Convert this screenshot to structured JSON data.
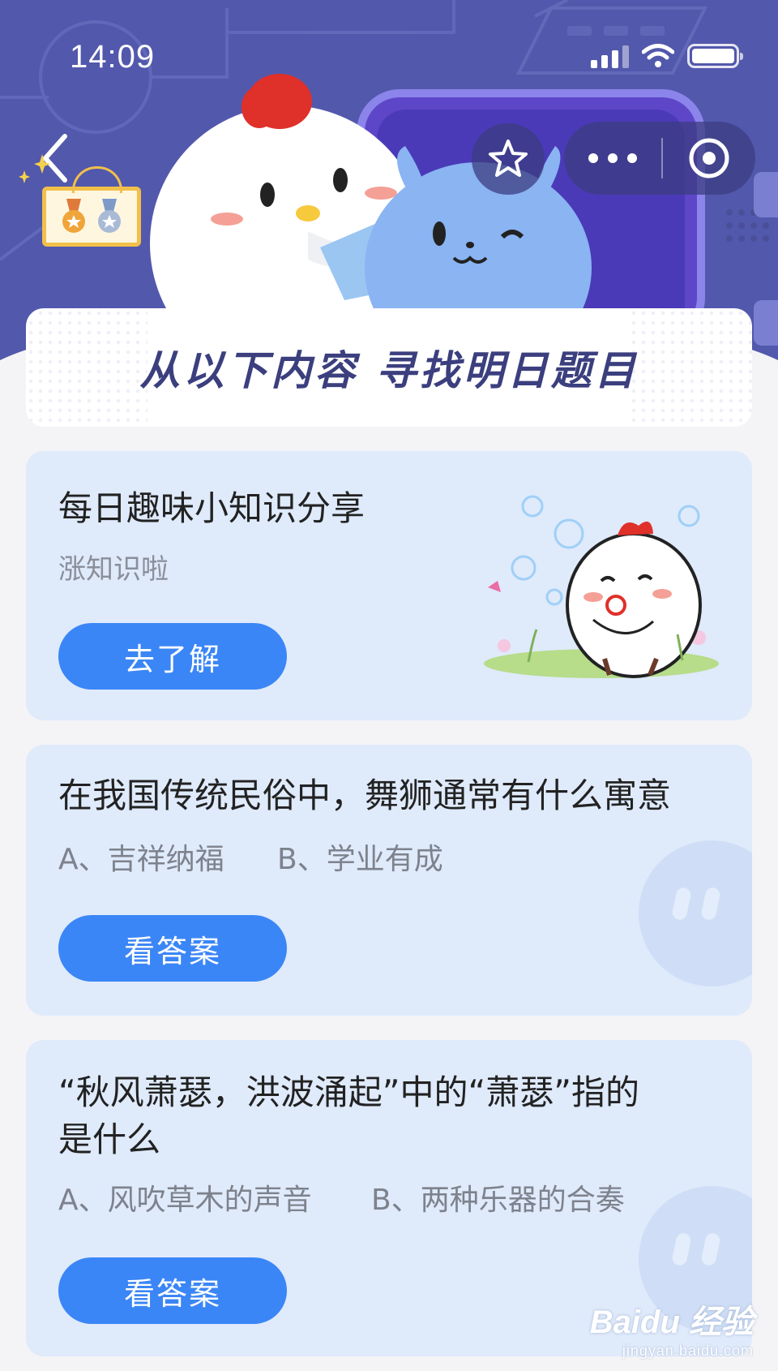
{
  "status_bar": {
    "time": "14:09"
  },
  "banner": {
    "title": "从以下内容  寻找明日题目"
  },
  "cards": [
    {
      "title": "每日趣味小知识分享",
      "subtitle": "涨知识啦",
      "button": "去了解"
    },
    {
      "title": "在我国传统民俗中，舞狮通常有什么寓意",
      "option_a": "A、吉祥纳福",
      "option_b": "B、学业有成",
      "button": "看答案"
    },
    {
      "title_line1": "“秋风萧瑟，洪波涌起”中的“萧瑟”指的",
      "title_line2": "是什么",
      "option_a": "A、风吹草木的声音",
      "option_b": "B、两种乐器的合奏",
      "button": "看答案"
    }
  ],
  "watermark": {
    "brand": "Baidu 经验",
    "url": "jingyan.baidu.com"
  },
  "colors": {
    "header_bg": "#5258ac",
    "card_bg": "#dfeafb",
    "button_blue": "#3b86f6",
    "banner_text": "#3b3f7e"
  },
  "icons": [
    "back-arrow-icon",
    "star-icon",
    "more-dots-icon",
    "target-icon",
    "signal-icon",
    "wifi-icon",
    "battery-icon",
    "medal-icon"
  ]
}
